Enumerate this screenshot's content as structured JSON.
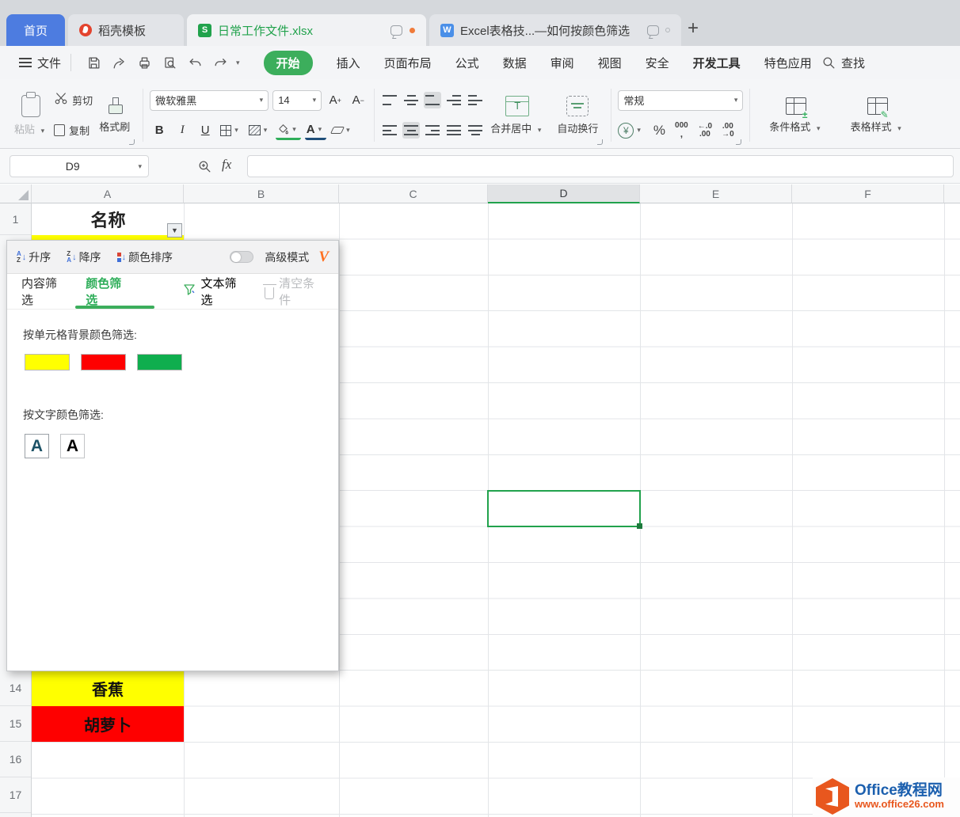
{
  "titlebar": {
    "home_tab": "首页",
    "docer_tab": "稻壳模板",
    "doc_tabs": [
      {
        "label": "日常工作文件.xlsx",
        "icon": "spreadsheet",
        "icon_letter": "S"
      },
      {
        "label": "Excel表格技...—如何按颜色筛选",
        "icon": "writer-doc",
        "icon_letter": "W"
      }
    ],
    "new_tab": "+"
  },
  "menu": {
    "file": "文件",
    "tabs": [
      "开始",
      "插入",
      "页面布局",
      "公式",
      "数据",
      "审阅",
      "视图",
      "安全",
      "开发工具",
      "特色应用"
    ],
    "active_tab": "开始",
    "search": "查找"
  },
  "ribbon": {
    "paste": "粘贴",
    "cut": "剪切",
    "copy": "复制",
    "format_painter": "格式刷",
    "font_name": "微软雅黑",
    "font_size": "14",
    "grow_font": "A",
    "shrink_font": "A",
    "bold": "B",
    "italic": "I",
    "underline": "U",
    "merge_center": "合并居中",
    "wrap_text": "自动换行",
    "number_format": "常规",
    "currency": "¥",
    "percent": "%",
    "thousands": "000",
    "thousands_comma": ",",
    "inc_decimal": "←.0",
    "dec_decimal": ".00",
    "cond_format": "条件格式",
    "table_style": "表格样式"
  },
  "formula_bar": {
    "cell_ref": "D9",
    "fx": "fx",
    "formula": ""
  },
  "filter_panel": {
    "sort_asc": "升序",
    "sort_desc": "降序",
    "sort_color": "颜色排序",
    "advanced_mode": "高级模式",
    "vip_glyph": "V",
    "sort_glyphs": {
      "a": "A",
      "z": "Z",
      "arrow": "↓"
    },
    "tab_content": "内容筛选",
    "tab_color": "颜色筛选",
    "tab_text": "文本筛选",
    "clear": "清空条件",
    "bg_filter_label": "按单元格背景颜色筛选:",
    "font_filter_label": "按文字颜色筛选:",
    "bg_colors": [
      "#ffff00",
      "#fe0000",
      "#0fae4e"
    ],
    "font_color_glyph": "A",
    "font_colors": [
      "#1b5166",
      "#000000"
    ]
  },
  "sheet": {
    "columns": [
      "A",
      "B",
      "C",
      "D",
      "E",
      "F"
    ],
    "selected_column": "D",
    "selected_cell": "D9",
    "row_numbers": {
      "r1": "1",
      "r14": "14",
      "r15": "15",
      "r16": "16",
      "r17": "17"
    },
    "cells": {
      "a1": {
        "text": "名称"
      },
      "a14": {
        "text": "香蕉",
        "bg": "#ffff00"
      },
      "a15": {
        "text": "胡萝卜",
        "bg": "#fe0000"
      }
    }
  },
  "watermark": {
    "title": "Office教程网",
    "url": "www.office26.com"
  },
  "colors": {
    "accent_green": "#21a24c",
    "home_tab_blue": "#4d7ce0",
    "active_pill_green": "#3cae5c",
    "vip_orange": "#ff6f1f",
    "watermark_blue": "#1b5fae",
    "watermark_orange": "#e8571e"
  }
}
